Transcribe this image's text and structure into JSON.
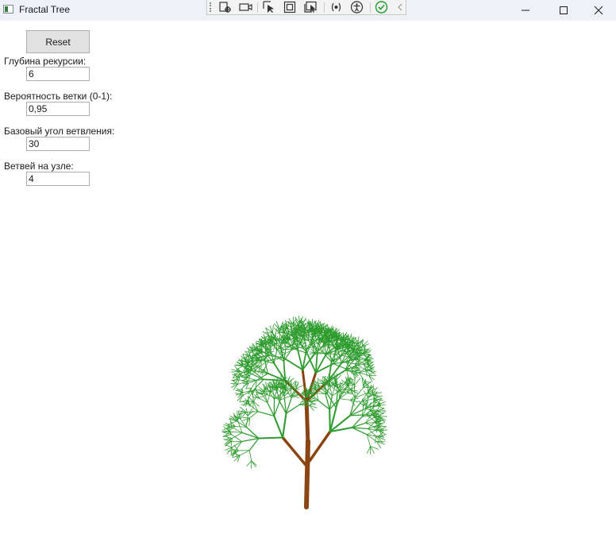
{
  "window": {
    "title": "Fractal Tree"
  },
  "controls": {
    "reset_label": "Reset",
    "recursion_depth": {
      "label": "Глубина рекурсии:",
      "value": "6"
    },
    "branch_probability": {
      "label": "Вероятность ветки (0-1):",
      "value": "0,95"
    },
    "base_angle": {
      "label": "Базовый угол ветвления:",
      "value": "30"
    },
    "branches_per_node": {
      "label": "Ветвей на узле:",
      "value": "4"
    }
  },
  "devtools_icons": [
    "select-element-icon",
    "record-icon",
    "pointer-icon",
    "layout-adorner-icon",
    "track-focus-icon",
    "binding-failures-icon",
    "accessibility-icon",
    "check-icon",
    "collapse-icon"
  ],
  "colors": {
    "trunk": "#8b4513",
    "foliage": "#2e9c2e",
    "titlebar": "#eef2f8"
  }
}
